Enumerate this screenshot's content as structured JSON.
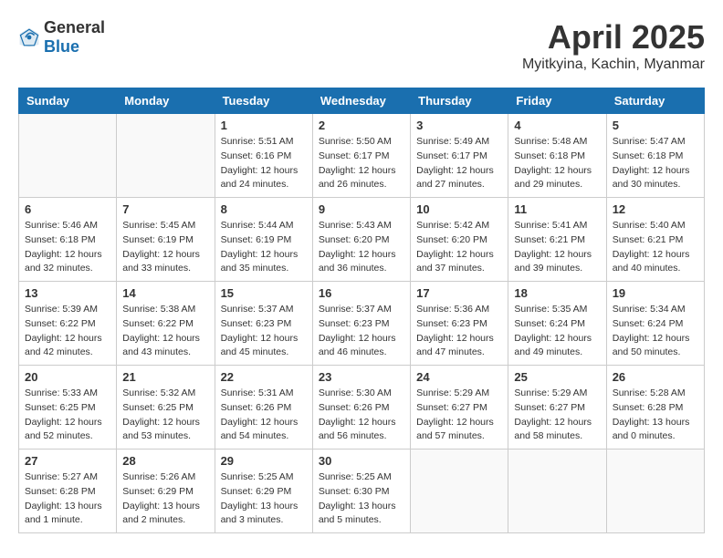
{
  "header": {
    "logo_general": "General",
    "logo_blue": "Blue",
    "month_title": "April 2025",
    "location": "Myitkyina, Kachin, Myanmar"
  },
  "calendar": {
    "weekdays": [
      "Sunday",
      "Monday",
      "Tuesday",
      "Wednesday",
      "Thursday",
      "Friday",
      "Saturday"
    ],
    "weeks": [
      [
        {
          "day": "",
          "info": ""
        },
        {
          "day": "",
          "info": ""
        },
        {
          "day": "1",
          "info": "Sunrise: 5:51 AM\nSunset: 6:16 PM\nDaylight: 12 hours and 24 minutes."
        },
        {
          "day": "2",
          "info": "Sunrise: 5:50 AM\nSunset: 6:17 PM\nDaylight: 12 hours and 26 minutes."
        },
        {
          "day": "3",
          "info": "Sunrise: 5:49 AM\nSunset: 6:17 PM\nDaylight: 12 hours and 27 minutes."
        },
        {
          "day": "4",
          "info": "Sunrise: 5:48 AM\nSunset: 6:18 PM\nDaylight: 12 hours and 29 minutes."
        },
        {
          "day": "5",
          "info": "Sunrise: 5:47 AM\nSunset: 6:18 PM\nDaylight: 12 hours and 30 minutes."
        }
      ],
      [
        {
          "day": "6",
          "info": "Sunrise: 5:46 AM\nSunset: 6:18 PM\nDaylight: 12 hours and 32 minutes."
        },
        {
          "day": "7",
          "info": "Sunrise: 5:45 AM\nSunset: 6:19 PM\nDaylight: 12 hours and 33 minutes."
        },
        {
          "day": "8",
          "info": "Sunrise: 5:44 AM\nSunset: 6:19 PM\nDaylight: 12 hours and 35 minutes."
        },
        {
          "day": "9",
          "info": "Sunrise: 5:43 AM\nSunset: 6:20 PM\nDaylight: 12 hours and 36 minutes."
        },
        {
          "day": "10",
          "info": "Sunrise: 5:42 AM\nSunset: 6:20 PM\nDaylight: 12 hours and 37 minutes."
        },
        {
          "day": "11",
          "info": "Sunrise: 5:41 AM\nSunset: 6:21 PM\nDaylight: 12 hours and 39 minutes."
        },
        {
          "day": "12",
          "info": "Sunrise: 5:40 AM\nSunset: 6:21 PM\nDaylight: 12 hours and 40 minutes."
        }
      ],
      [
        {
          "day": "13",
          "info": "Sunrise: 5:39 AM\nSunset: 6:22 PM\nDaylight: 12 hours and 42 minutes."
        },
        {
          "day": "14",
          "info": "Sunrise: 5:38 AM\nSunset: 6:22 PM\nDaylight: 12 hours and 43 minutes."
        },
        {
          "day": "15",
          "info": "Sunrise: 5:37 AM\nSunset: 6:23 PM\nDaylight: 12 hours and 45 minutes."
        },
        {
          "day": "16",
          "info": "Sunrise: 5:37 AM\nSunset: 6:23 PM\nDaylight: 12 hours and 46 minutes."
        },
        {
          "day": "17",
          "info": "Sunrise: 5:36 AM\nSunset: 6:23 PM\nDaylight: 12 hours and 47 minutes."
        },
        {
          "day": "18",
          "info": "Sunrise: 5:35 AM\nSunset: 6:24 PM\nDaylight: 12 hours and 49 minutes."
        },
        {
          "day": "19",
          "info": "Sunrise: 5:34 AM\nSunset: 6:24 PM\nDaylight: 12 hours and 50 minutes."
        }
      ],
      [
        {
          "day": "20",
          "info": "Sunrise: 5:33 AM\nSunset: 6:25 PM\nDaylight: 12 hours and 52 minutes."
        },
        {
          "day": "21",
          "info": "Sunrise: 5:32 AM\nSunset: 6:25 PM\nDaylight: 12 hours and 53 minutes."
        },
        {
          "day": "22",
          "info": "Sunrise: 5:31 AM\nSunset: 6:26 PM\nDaylight: 12 hours and 54 minutes."
        },
        {
          "day": "23",
          "info": "Sunrise: 5:30 AM\nSunset: 6:26 PM\nDaylight: 12 hours and 56 minutes."
        },
        {
          "day": "24",
          "info": "Sunrise: 5:29 AM\nSunset: 6:27 PM\nDaylight: 12 hours and 57 minutes."
        },
        {
          "day": "25",
          "info": "Sunrise: 5:29 AM\nSunset: 6:27 PM\nDaylight: 12 hours and 58 minutes."
        },
        {
          "day": "26",
          "info": "Sunrise: 5:28 AM\nSunset: 6:28 PM\nDaylight: 13 hours and 0 minutes."
        }
      ],
      [
        {
          "day": "27",
          "info": "Sunrise: 5:27 AM\nSunset: 6:28 PM\nDaylight: 13 hours and 1 minute."
        },
        {
          "day": "28",
          "info": "Sunrise: 5:26 AM\nSunset: 6:29 PM\nDaylight: 13 hours and 2 minutes."
        },
        {
          "day": "29",
          "info": "Sunrise: 5:25 AM\nSunset: 6:29 PM\nDaylight: 13 hours and 3 minutes."
        },
        {
          "day": "30",
          "info": "Sunrise: 5:25 AM\nSunset: 6:30 PM\nDaylight: 13 hours and 5 minutes."
        },
        {
          "day": "",
          "info": ""
        },
        {
          "day": "",
          "info": ""
        },
        {
          "day": "",
          "info": ""
        }
      ]
    ]
  }
}
